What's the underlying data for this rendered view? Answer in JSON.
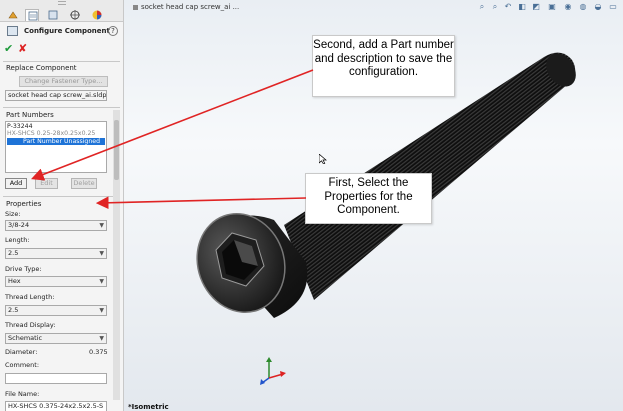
{
  "property_manager": {
    "title": "Configure Component",
    "help_glyph": "?",
    "ok_glyph": "✔",
    "cancel_glyph": "✘",
    "replace_section": {
      "title": "Replace Component",
      "change_button": "Change Fastener Type...",
      "file_field": "socket head cap screw_ai.sldprt"
    },
    "part_numbers_section": {
      "title": "Part Numbers",
      "items": [
        {
          "text": "P-33244",
          "style": "normal"
        },
        {
          "text": "HX-SHCS 0.25-28x0.25x0.25",
          "style": "grey"
        },
        {
          "text": "Part Number Unassigned",
          "style": "selected"
        }
      ],
      "add_button": "Add",
      "edit_button": "Edit",
      "delete_button": "Delete"
    },
    "properties_section": {
      "title": "Properties",
      "size_label": "Size:",
      "size_value": "3/8-24",
      "length_label": "Length:",
      "length_value": "2.5",
      "drive_label": "Drive Type:",
      "drive_value": "Hex",
      "thread_length_label": "Thread Length:",
      "thread_length_value": "2.5",
      "thread_display_label": "Thread Display:",
      "thread_display_value": "Schematic",
      "diameter_label": "Diameter:",
      "diameter_value": "0.375",
      "comment_label": "Comment:",
      "comment_value": "",
      "file_name_label": "File Name:",
      "file_name_value": "HX-SHCS 0.375-24x2.5x2.5-S"
    }
  },
  "viewport": {
    "document_title": "socket head cap screw_ai ...",
    "view_label": "*Isometric",
    "callout_second": "Second, add a Part number and description to save the configuration.",
    "callout_first": "First, Select the Properties for the Component.",
    "arrow_color": "#e02424",
    "screw_color": "#1a1a1a"
  }
}
